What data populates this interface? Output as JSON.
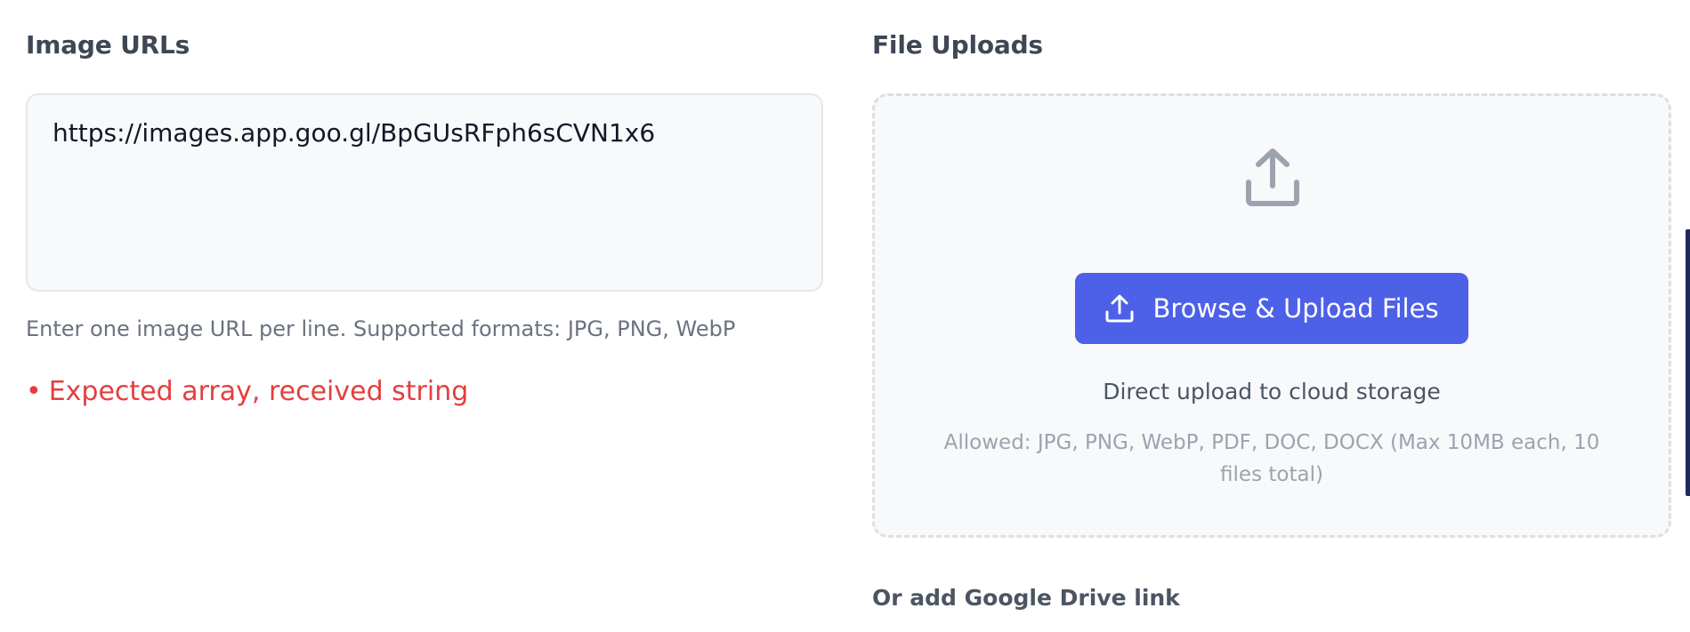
{
  "image_urls": {
    "title": "Image URLs",
    "value": "https://images.app.goo.gl/BpGUsRFph6sCVN1x6",
    "helper": "Enter one image URL per line. Supported formats: JPG, PNG, WebP",
    "error_bullet": "•",
    "error": "Expected array, received string"
  },
  "file_uploads": {
    "title": "File Uploads",
    "upload_icon": "upload-icon",
    "browse_button_label": "Browse & Upload Files",
    "direct_text": "Direct upload to cloud storage",
    "allowed_text": "Allowed: JPG, PNG, WebP, PDF, DOC, DOCX (Max 10MB each, 10 files total)",
    "google_drive_label": "Or add Google Drive link"
  },
  "colors": {
    "primary_button": "#4d60e8",
    "error": "#e53e3e",
    "helper_text": "#6b7280"
  }
}
